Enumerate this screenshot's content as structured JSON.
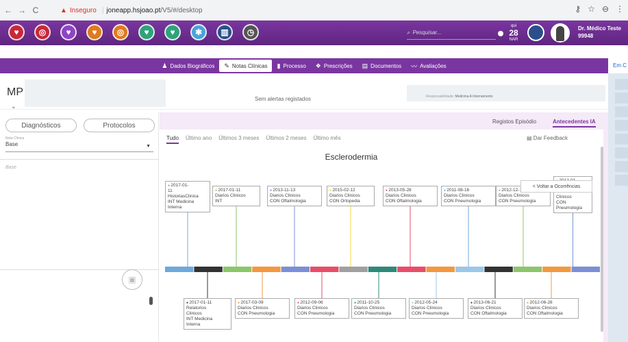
{
  "browser": {
    "security_label": "Inseguro",
    "url_host": "joneapp.hsjoao.pt",
    "url_path": "/V5/#/desktop"
  },
  "appbar": {
    "search_placeholder": "Pesquisar...",
    "calendar_day_name": "qui",
    "calendar_day": "28",
    "calendar_month": "NAR",
    "user_name": "Dr. Médico Teste",
    "user_id": "99948"
  },
  "tabs": [
    {
      "label": "Dados Biográficos",
      "icon": "person-icon"
    },
    {
      "label": "Notas Clínicas",
      "icon": "pencil-icon"
    },
    {
      "label": "Processo",
      "icon": "book-icon"
    },
    {
      "label": "Prescrições",
      "icon": "pills-icon"
    },
    {
      "label": "Documentos",
      "icon": "document-icon"
    },
    {
      "label": "Avaliações",
      "icon": "chart-line-icon"
    }
  ],
  "right_strip_label": "Em C",
  "patient": {
    "initials": "MP",
    "alerts": "Sem alertas registados",
    "responsibility_label": "Responsabilidade:",
    "responsibility_value": "Medicina A Internamento"
  },
  "left_panel": {
    "btn_diagnosticos": "Diagnósticos",
    "btn_protocolos": "Protocolos",
    "nota_label": "Nota Clínica",
    "nota_value": "Base",
    "text_placeholder": "Base"
  },
  "panel": {
    "link_registos": "Registos Episódio",
    "link_antecedentes": "Antecedentes IA",
    "filters": [
      "Tudo",
      "Último ano",
      "Últimos 3 meses",
      "Últimos 2 meses",
      "Último mês"
    ],
    "feedback": "Dar Feedback",
    "title": "Esclerodermia",
    "voltar": "< Voltar a Ocorrências"
  },
  "timeline": {
    "segment_colors": [
      "#6ea8dc",
      "#333333",
      "#8cc66a",
      "#f3983f",
      "#7b8fd6",
      "#e84d6a",
      "#a0a0a0",
      "#2e8a78",
      "#e84d6a",
      "#f3983f",
      "#9bc7e8",
      "#333333",
      "#8cc66a",
      "#f3983f",
      "#7b8fd6"
    ],
    "top_events": [
      {
        "date": "2017-01-11",
        "color": "#6ea8dc",
        "lines": [
          "2017-01-",
          "11",
          "HistoriasClinica",
          "INT Medicina",
          "Interna"
        ]
      },
      {
        "date": "2017-01-11",
        "color": "#8cc66a",
        "lines": [
          "2017-01-11",
          "Diarios Clinicos",
          "INT"
        ]
      },
      {
        "date": "2013-11-13",
        "color": "#7b8fd6",
        "lines": [
          "2013-11-13",
          "Diarios Clinicos",
          "CON Oftalmologia"
        ]
      },
      {
        "date": "2015-02-12",
        "color": "#f3d43f",
        "lines": [
          "2015-02-12",
          "Diarios Clinicos",
          "CON Ortopedia"
        ]
      },
      {
        "date": "2013-05-28",
        "color": "#e84d6a",
        "lines": [
          "2013-05-28",
          "Diarios Clinicos",
          "CON Oftalmologia"
        ]
      },
      {
        "date": "2011-08-16",
        "color": "#6ea8dc",
        "lines": [
          "2011-08-16",
          "Diarios Clinicos",
          "CON Pneumologia"
        ]
      },
      {
        "date": "2012-12-13",
        "color": "#8cc66a",
        "lines": [
          "2012-12-13",
          "Diarios Clinicos",
          "CON Pneumologia"
        ]
      },
      {
        "date": "2012-01-16",
        "color": "#7b8fd6",
        "lines": [
          "2012-01-",
          "16",
          "Diarios",
          "Clinicos",
          "CON",
          "Pneumologia"
        ]
      }
    ],
    "bottom_events": [
      {
        "date": "2017-01-11",
        "color": "#333333",
        "lines": [
          "2017-01-11",
          "Relatorios",
          "Clinicos",
          "INT Medicina",
          "Interna"
        ]
      },
      {
        "date": "2017-03-09",
        "color": "#f3983f",
        "lines": [
          "2017-03-09",
          "Diarios Clinicos",
          "CON Pneumologia"
        ]
      },
      {
        "date": "2012-09-06",
        "color": "#e84d6a",
        "lines": [
          "2012-09-06",
          "Diarios Clinicos",
          "CON Pneumologia"
        ]
      },
      {
        "date": "2011-10-25",
        "color": "#2e8a78",
        "lines": [
          "2011-10-25",
          "Diarios Clinicos",
          "CON Pneumologia"
        ]
      },
      {
        "date": "2012-05-24",
        "color": "#9bc7e8",
        "lines": [
          "2012-05-24",
          "Diarios Clinicos",
          "CON Pneumologia"
        ]
      },
      {
        "date": "2013-06-21",
        "color": "#333333",
        "lines": [
          "2013-06-21",
          "Diarios Clinicos",
          "CON Oftalmologia"
        ]
      },
      {
        "date": "2012-06-28",
        "color": "#f3983f",
        "lines": [
          "2012-06-28",
          "Diarios Clinicos",
          "CON Oftalmologia"
        ]
      }
    ]
  },
  "app_icons": [
    "heart-icon",
    "target-icon",
    "heart-icon",
    "heart-icon",
    "ring-icon",
    "heart-icon",
    "heart-icon",
    "snowflake-icon",
    "book-icon",
    "gauge-icon"
  ]
}
